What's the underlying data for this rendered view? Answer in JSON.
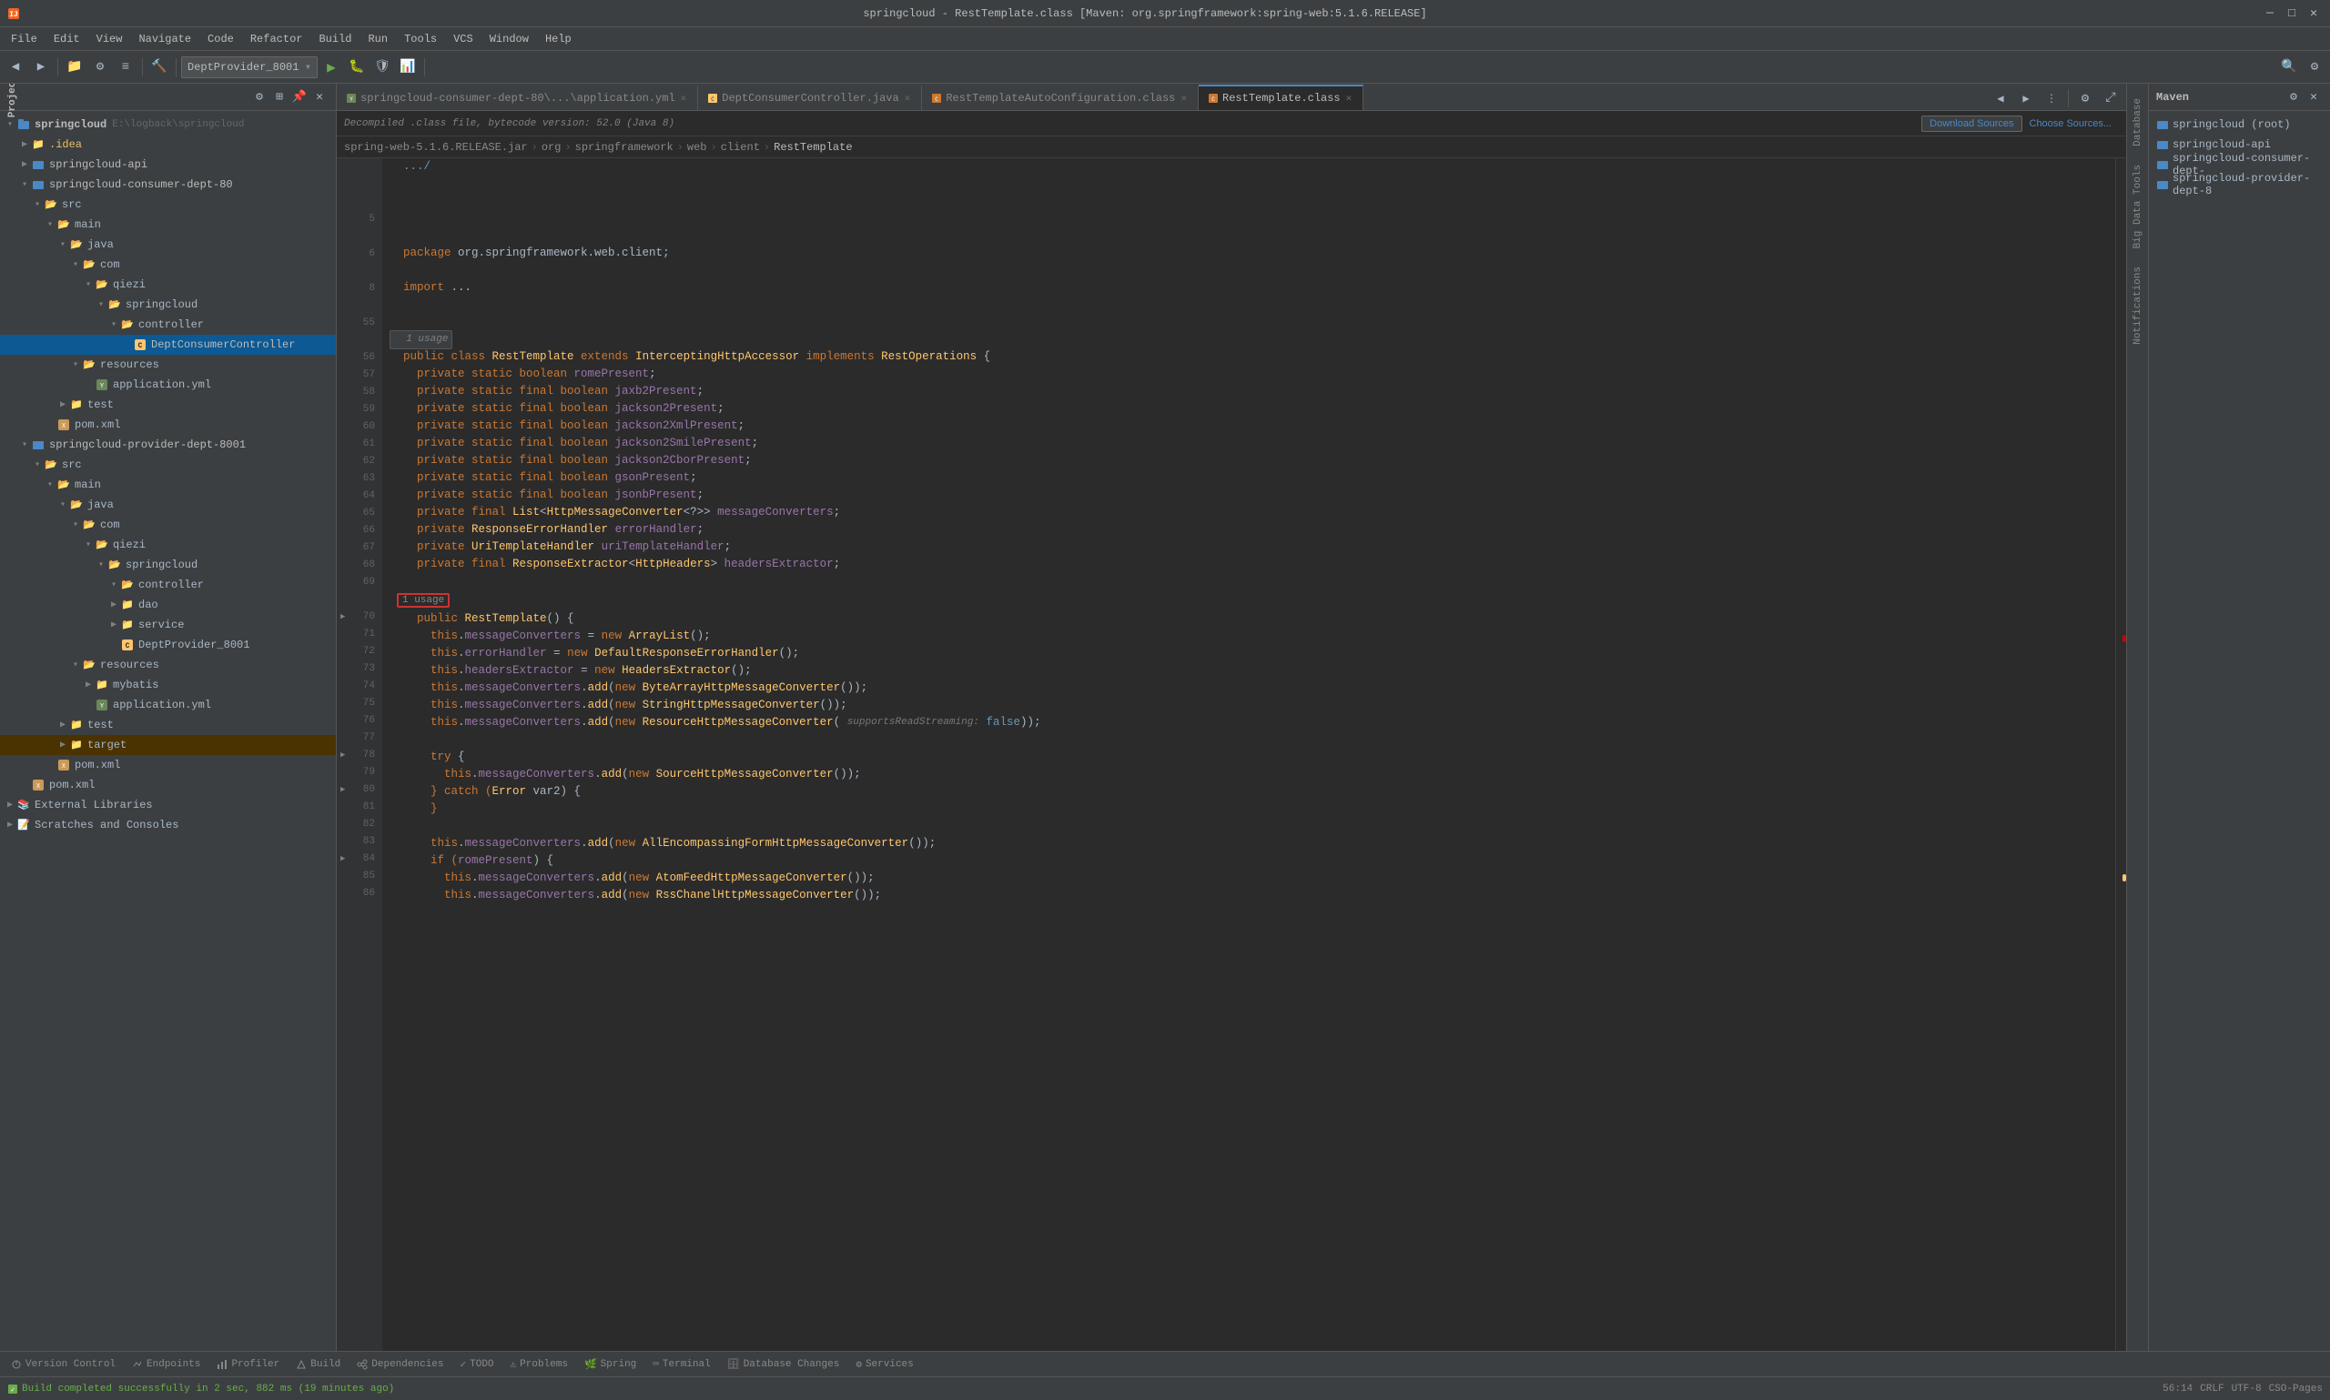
{
  "app": {
    "title": "springcloud - RestTemplate.class [Maven: org.springframework:spring-web:5.1.6.RELEASE]",
    "jar_path": "spring-web-5.1.6.RELEASE.jar › org › springframework › web › client › RestTemplate"
  },
  "menu": {
    "items": [
      "File",
      "Edit",
      "View",
      "Navigate",
      "Code",
      "Refactor",
      "Build",
      "Run",
      "Tools",
      "VCS",
      "Window",
      "Help"
    ]
  },
  "toolbar": {
    "project_dropdown": "DeptProvider_8001",
    "run_label": "▶",
    "debug_label": "🐛"
  },
  "project_panel": {
    "title": "Project",
    "items": [
      {
        "label": "springcloud",
        "path": "E:\\logback\\springcloud",
        "level": 0,
        "type": "root",
        "expanded": true
      },
      {
        "label": ".idea",
        "level": 1,
        "type": "folder",
        "expanded": false
      },
      {
        "label": "springcloud-api",
        "level": 1,
        "type": "module",
        "expanded": false
      },
      {
        "label": "springcloud-consumer-dept-80",
        "level": 1,
        "type": "module",
        "expanded": true
      },
      {
        "label": "src",
        "level": 2,
        "type": "folder",
        "expanded": true
      },
      {
        "label": "main",
        "level": 3,
        "type": "folder",
        "expanded": true
      },
      {
        "label": "java",
        "level": 4,
        "type": "folder",
        "expanded": true
      },
      {
        "label": "com",
        "level": 5,
        "type": "folder",
        "expanded": true
      },
      {
        "label": "qiezi",
        "level": 6,
        "type": "folder",
        "expanded": true
      },
      {
        "label": "springcloud",
        "level": 7,
        "type": "folder",
        "expanded": true
      },
      {
        "label": "controller",
        "level": 8,
        "type": "folder",
        "expanded": true
      },
      {
        "label": "DeptConsumerController",
        "level": 9,
        "type": "java",
        "selected": true
      },
      {
        "label": "resources",
        "level": 4,
        "type": "folder",
        "expanded": true
      },
      {
        "label": "application.yml",
        "level": 5,
        "type": "yaml"
      },
      {
        "label": "test",
        "level": 3,
        "type": "folder",
        "expanded": false
      },
      {
        "label": "pom.xml",
        "level": 2,
        "type": "xml"
      },
      {
        "label": "springcloud-provider-dept-8001",
        "level": 1,
        "type": "module",
        "expanded": true
      },
      {
        "label": "src",
        "level": 2,
        "type": "folder",
        "expanded": true
      },
      {
        "label": "main",
        "level": 3,
        "type": "folder",
        "expanded": true
      },
      {
        "label": "java",
        "level": 4,
        "type": "folder",
        "expanded": true
      },
      {
        "label": "com",
        "level": 5,
        "type": "folder",
        "expanded": true
      },
      {
        "label": "qiezi",
        "level": 6,
        "type": "folder",
        "expanded": true
      },
      {
        "label": "springcloud",
        "level": 7,
        "type": "folder",
        "expanded": true
      },
      {
        "label": "controller",
        "level": 8,
        "type": "folder",
        "expanded": true
      },
      {
        "label": "dao",
        "level": 8,
        "type": "folder",
        "expanded": false
      },
      {
        "label": "service",
        "level": 8,
        "type": "folder",
        "expanded": false
      },
      {
        "label": "DeptProvider_8001",
        "level": 9,
        "type": "java"
      },
      {
        "label": "resources",
        "level": 4,
        "type": "folder",
        "expanded": true
      },
      {
        "label": "mybatis",
        "level": 5,
        "type": "folder",
        "expanded": false
      },
      {
        "label": "application.yml",
        "level": 5,
        "type": "yaml"
      },
      {
        "label": "test",
        "level": 3,
        "type": "folder",
        "expanded": false
      },
      {
        "label": "target",
        "level": 3,
        "type": "folder",
        "expanded": false
      },
      {
        "label": "pom.xml",
        "level": 2,
        "type": "xml"
      },
      {
        "label": "pom.xml",
        "level": 1,
        "type": "xml"
      },
      {
        "label": "External Libraries",
        "level": 0,
        "type": "lib",
        "expanded": false
      },
      {
        "label": "Scratches and Consoles",
        "level": 0,
        "type": "scratch",
        "expanded": false
      }
    ]
  },
  "tabs": [
    {
      "label": "application.yml",
      "icon": "yaml",
      "active": false,
      "closable": true
    },
    {
      "label": "DeptConsumerController.java",
      "icon": "java",
      "active": false,
      "closable": true
    },
    {
      "label": "RestTemplateAutoConfiguration.class",
      "icon": "class",
      "active": false,
      "closable": true
    },
    {
      "label": "RestTemplate.class",
      "icon": "class",
      "active": true,
      "closable": true
    }
  ],
  "file_info": {
    "text": "Decompiled .class file, bytecode version: 52.0 (Java 8)",
    "download_sources": "Download Sources",
    "choose_sources": "Choose Sources..."
  },
  "breadcrumb": [
    "spring-web-5.1.6.RELEASE.jar",
    "org",
    "springframework",
    "web",
    "client",
    "RestTemplate"
  ],
  "code": {
    "lines": [
      {
        "num": "",
        "content": "  .../"
      },
      {
        "num": "",
        "content": ""
      },
      {
        "num": "",
        "content": ""
      },
      {
        "num": "",
        "content": ""
      },
      {
        "num": "5",
        "content": ""
      },
      {
        "num": "",
        "content": ""
      },
      {
        "num": "6",
        "content": "  package org.springframework.web.client;"
      },
      {
        "num": "",
        "content": ""
      },
      {
        "num": "",
        "content": ""
      },
      {
        "num": "8",
        "content": "  import ..."
      },
      {
        "num": "",
        "content": ""
      },
      {
        "num": "55",
        "content": ""
      },
      {
        "num": "",
        "content": "  1 usage"
      },
      {
        "num": "56",
        "content": "  public class RestTemplate extends InterceptingHttpAccessor implements RestOperations {"
      },
      {
        "num": "57",
        "content": "    private static boolean romePresent;"
      },
      {
        "num": "58",
        "content": "    private static final boolean jaxb2Present;"
      },
      {
        "num": "59",
        "content": "    private static final boolean jackson2Present;"
      },
      {
        "num": "60",
        "content": "    private static final boolean jackson2XmlPresent;"
      },
      {
        "num": "61",
        "content": "    private static final boolean jackson2SmilePresent;"
      },
      {
        "num": "62",
        "content": "    private static final boolean jackson2CborPresent;"
      },
      {
        "num": "63",
        "content": "    private static final boolean gsonPresent;"
      },
      {
        "num": "64",
        "content": "    private static final boolean jsonbPresent;"
      },
      {
        "num": "65",
        "content": "    private final List<HttpMessageConverter<?>> messageConverters;"
      },
      {
        "num": "66",
        "content": "    private ResponseErrorHandler errorHandler;"
      },
      {
        "num": "67",
        "content": "    private UriTemplateHandler uriTemplateHandler;"
      },
      {
        "num": "68",
        "content": "    private final ResponseExtractor<HttpHeaders> headersExtractor;"
      },
      {
        "num": "69",
        "content": ""
      },
      {
        "num": "USAGE_BOX",
        "content": "  1 usage"
      },
      {
        "num": "70",
        "content": "    public RestTemplate() {"
      },
      {
        "num": "71",
        "content": "      this.messageConverters = new ArrayList();"
      },
      {
        "num": "72",
        "content": "      this.errorHandler = new DefaultResponseErrorHandler();"
      },
      {
        "num": "73",
        "content": "      this.headersExtractor = new HeadersExtractor();"
      },
      {
        "num": "74",
        "content": "      this.messageConverters.add(new ByteArrayHttpMessageConverter());"
      },
      {
        "num": "75",
        "content": "      this.messageConverters.add(new StringHttpMessageConverter());"
      },
      {
        "num": "76",
        "content": "      this.messageConverters.add(new ResourceHttpMessageConverter( supportsReadStreaming: false));"
      },
      {
        "num": "77",
        "content": ""
      },
      {
        "num": "78",
        "content": "      try {"
      },
      {
        "num": "79",
        "content": "        this.messageConverters.add(new SourceHttpMessageConverter());"
      },
      {
        "num": "80",
        "content": "      } catch (Error var2) {"
      },
      {
        "num": "81",
        "content": "      }"
      },
      {
        "num": "82",
        "content": ""
      },
      {
        "num": "83",
        "content": "      this.messageConverters.add(new AllEncompassingFormHttpMessageConverter());"
      },
      {
        "num": "84",
        "content": "      if (romePresent) {"
      },
      {
        "num": "85",
        "content": "        this.messageConverters.add(new AtomFeedHttpMessageConverter());"
      },
      {
        "num": "86",
        "content": "        this.messageConverters.add(new RssChanelHttpMessageConverter());"
      }
    ]
  },
  "maven_panel": {
    "title": "Maven",
    "items": [
      {
        "label": "springcloud (root)",
        "level": 0,
        "type": "root"
      },
      {
        "label": "springcloud-api",
        "level": 0,
        "type": "module"
      },
      {
        "label": "springcloud-consumer-dept-",
        "level": 0,
        "type": "module"
      },
      {
        "label": "springcloud-provider-dept-8",
        "level": 0,
        "type": "module"
      }
    ]
  },
  "side_tabs_right": [
    "Database",
    "Big Data Tools",
    "Notifications"
  ],
  "bottom_toolbar": {
    "tabs": [
      "Version Control",
      "Endpoints",
      "Profiler",
      "Build",
      "Dependencies",
      "TODO",
      "Problems",
      "Spring",
      "Terminal",
      "Database Changes",
      "Services"
    ]
  },
  "status_bar": {
    "build_status": "Build completed successfully in 2 sec, 882 ms (19 minutes ago)",
    "position": "56:14",
    "encoding": "CRLF",
    "charset": "UTF-8",
    "icon_label": "CSO-Pages"
  }
}
